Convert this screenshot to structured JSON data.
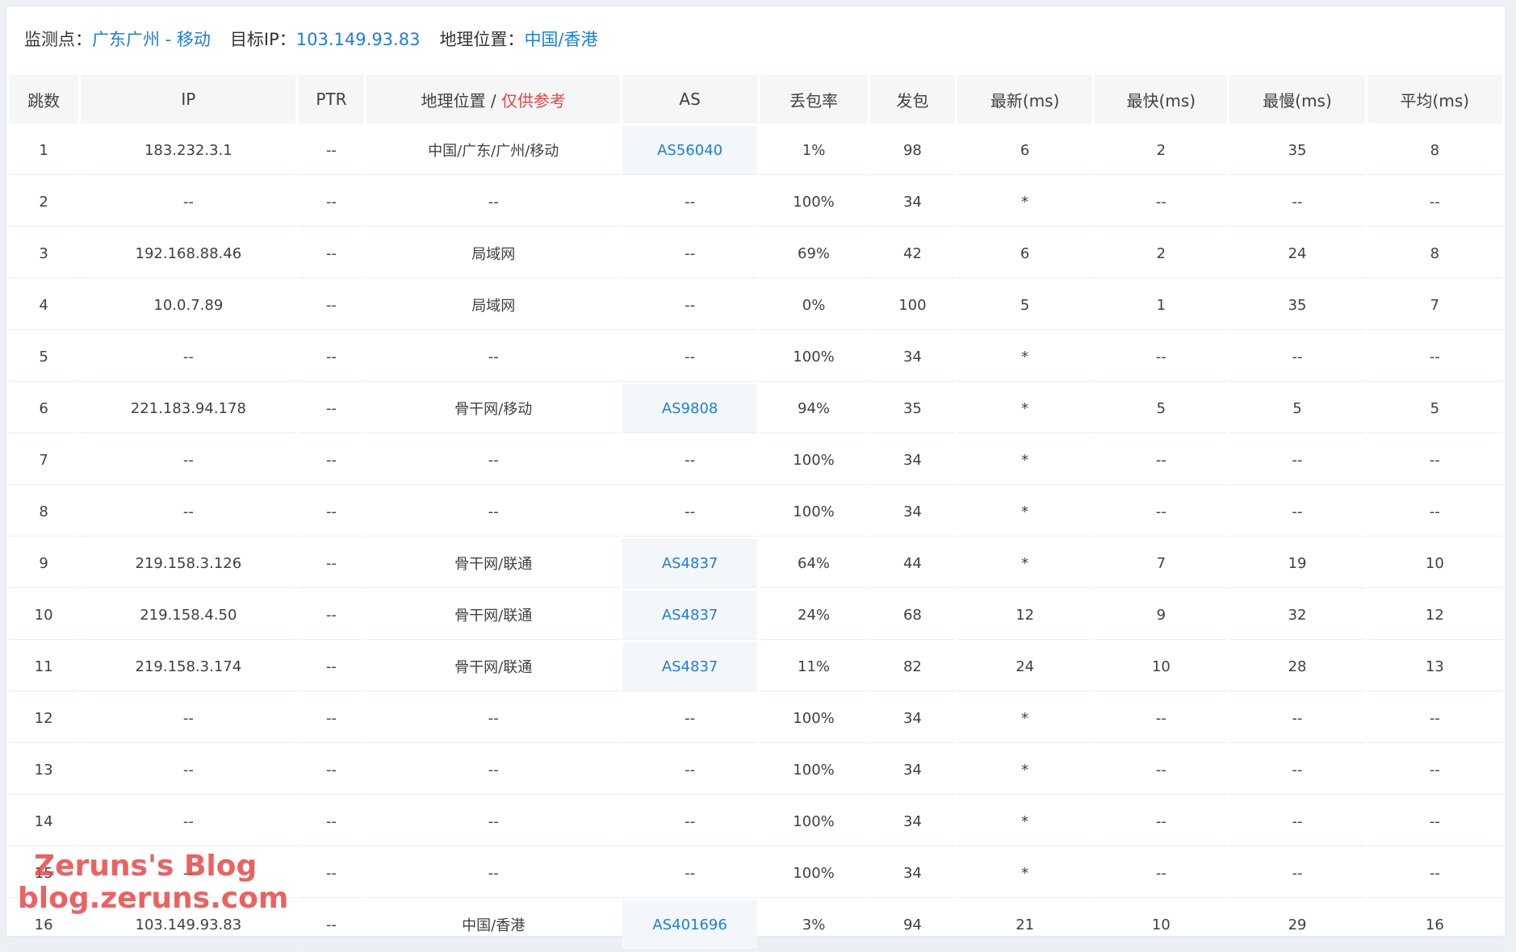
{
  "info": {
    "monitor_label": "监测点：",
    "monitor_value": "广东广州 - 移动",
    "target_label": "目标IP：",
    "target_value": "103.149.93.83",
    "geo_label": "地理位置：",
    "geo_value": "中国/香港"
  },
  "table": {
    "headers": {
      "hop": "跳数",
      "ip": "IP",
      "ptr": "PTR",
      "geo": "地理位置 / ",
      "geo_note": "仅供参考",
      "as": "AS",
      "loss": "丢包率",
      "sent": "发包",
      "last": "最新(ms)",
      "best": "最快(ms)",
      "worst": "最慢(ms)",
      "avg": "平均(ms)"
    },
    "rows": [
      {
        "hop": "1",
        "ip": "183.232.3.1",
        "ptr": "--",
        "geo": "中国/广东/广州/移动",
        "as": "AS56040",
        "loss": "1%",
        "sent": "98",
        "last": "6",
        "best": "2",
        "worst": "35",
        "avg": "8"
      },
      {
        "hop": "2",
        "ip": "--",
        "ptr": "--",
        "geo": "--",
        "as": "--",
        "loss": "100%",
        "sent": "34",
        "last": "*",
        "best": "--",
        "worst": "--",
        "avg": "--"
      },
      {
        "hop": "3",
        "ip": "192.168.88.46",
        "ptr": "--",
        "geo": "局域网",
        "as": "--",
        "loss": "69%",
        "sent": "42",
        "last": "6",
        "best": "2",
        "worst": "24",
        "avg": "8"
      },
      {
        "hop": "4",
        "ip": "10.0.7.89",
        "ptr": "--",
        "geo": "局域网",
        "as": "--",
        "loss": "0%",
        "sent": "100",
        "last": "5",
        "best": "1",
        "worst": "35",
        "avg": "7"
      },
      {
        "hop": "5",
        "ip": "--",
        "ptr": "--",
        "geo": "--",
        "as": "--",
        "loss": "100%",
        "sent": "34",
        "last": "*",
        "best": "--",
        "worst": "--",
        "avg": "--"
      },
      {
        "hop": "6",
        "ip": "221.183.94.178",
        "ptr": "--",
        "geo": "骨干网/移动",
        "as": "AS9808",
        "loss": "94%",
        "sent": "35",
        "last": "*",
        "best": "5",
        "worst": "5",
        "avg": "5"
      },
      {
        "hop": "7",
        "ip": "--",
        "ptr": "--",
        "geo": "--",
        "as": "--",
        "loss": "100%",
        "sent": "34",
        "last": "*",
        "best": "--",
        "worst": "--",
        "avg": "--"
      },
      {
        "hop": "8",
        "ip": "--",
        "ptr": "--",
        "geo": "--",
        "as": "--",
        "loss": "100%",
        "sent": "34",
        "last": "*",
        "best": "--",
        "worst": "--",
        "avg": "--"
      },
      {
        "hop": "9",
        "ip": "219.158.3.126",
        "ptr": "--",
        "geo": "骨干网/联通",
        "as": "AS4837",
        "loss": "64%",
        "sent": "44",
        "last": "*",
        "best": "7",
        "worst": "19",
        "avg": "10"
      },
      {
        "hop": "10",
        "ip": "219.158.4.50",
        "ptr": "--",
        "geo": "骨干网/联通",
        "as": "AS4837",
        "loss": "24%",
        "sent": "68",
        "last": "12",
        "best": "9",
        "worst": "32",
        "avg": "12"
      },
      {
        "hop": "11",
        "ip": "219.158.3.174",
        "ptr": "--",
        "geo": "骨干网/联通",
        "as": "AS4837",
        "loss": "11%",
        "sent": "82",
        "last": "24",
        "best": "10",
        "worst": "28",
        "avg": "13"
      },
      {
        "hop": "12",
        "ip": "--",
        "ptr": "--",
        "geo": "--",
        "as": "--",
        "loss": "100%",
        "sent": "34",
        "last": "*",
        "best": "--",
        "worst": "--",
        "avg": "--"
      },
      {
        "hop": "13",
        "ip": "--",
        "ptr": "--",
        "geo": "--",
        "as": "--",
        "loss": "100%",
        "sent": "34",
        "last": "*",
        "best": "--",
        "worst": "--",
        "avg": "--"
      },
      {
        "hop": "14",
        "ip": "--",
        "ptr": "--",
        "geo": "--",
        "as": "--",
        "loss": "100%",
        "sent": "34",
        "last": "*",
        "best": "--",
        "worst": "--",
        "avg": "--"
      },
      {
        "hop": "15",
        "ip": "--",
        "ptr": "--",
        "geo": "--",
        "as": "--",
        "loss": "100%",
        "sent": "34",
        "last": "*",
        "best": "--",
        "worst": "--",
        "avg": "--"
      },
      {
        "hop": "16",
        "ip": "103.149.93.83",
        "ptr": "--",
        "geo": "中国/香港",
        "as": "AS401696",
        "loss": "3%",
        "sent": "94",
        "last": "21",
        "best": "10",
        "worst": "29",
        "avg": "16"
      }
    ]
  },
  "watermark": {
    "line1": "Zeruns's Blog",
    "line2": "blog.zeruns.com"
  },
  "colors": {
    "link": "#1a7fe0",
    "note": "#e84545",
    "header_bg": "#f5f6f7",
    "as_cell_bg": "#f4f7fa"
  }
}
